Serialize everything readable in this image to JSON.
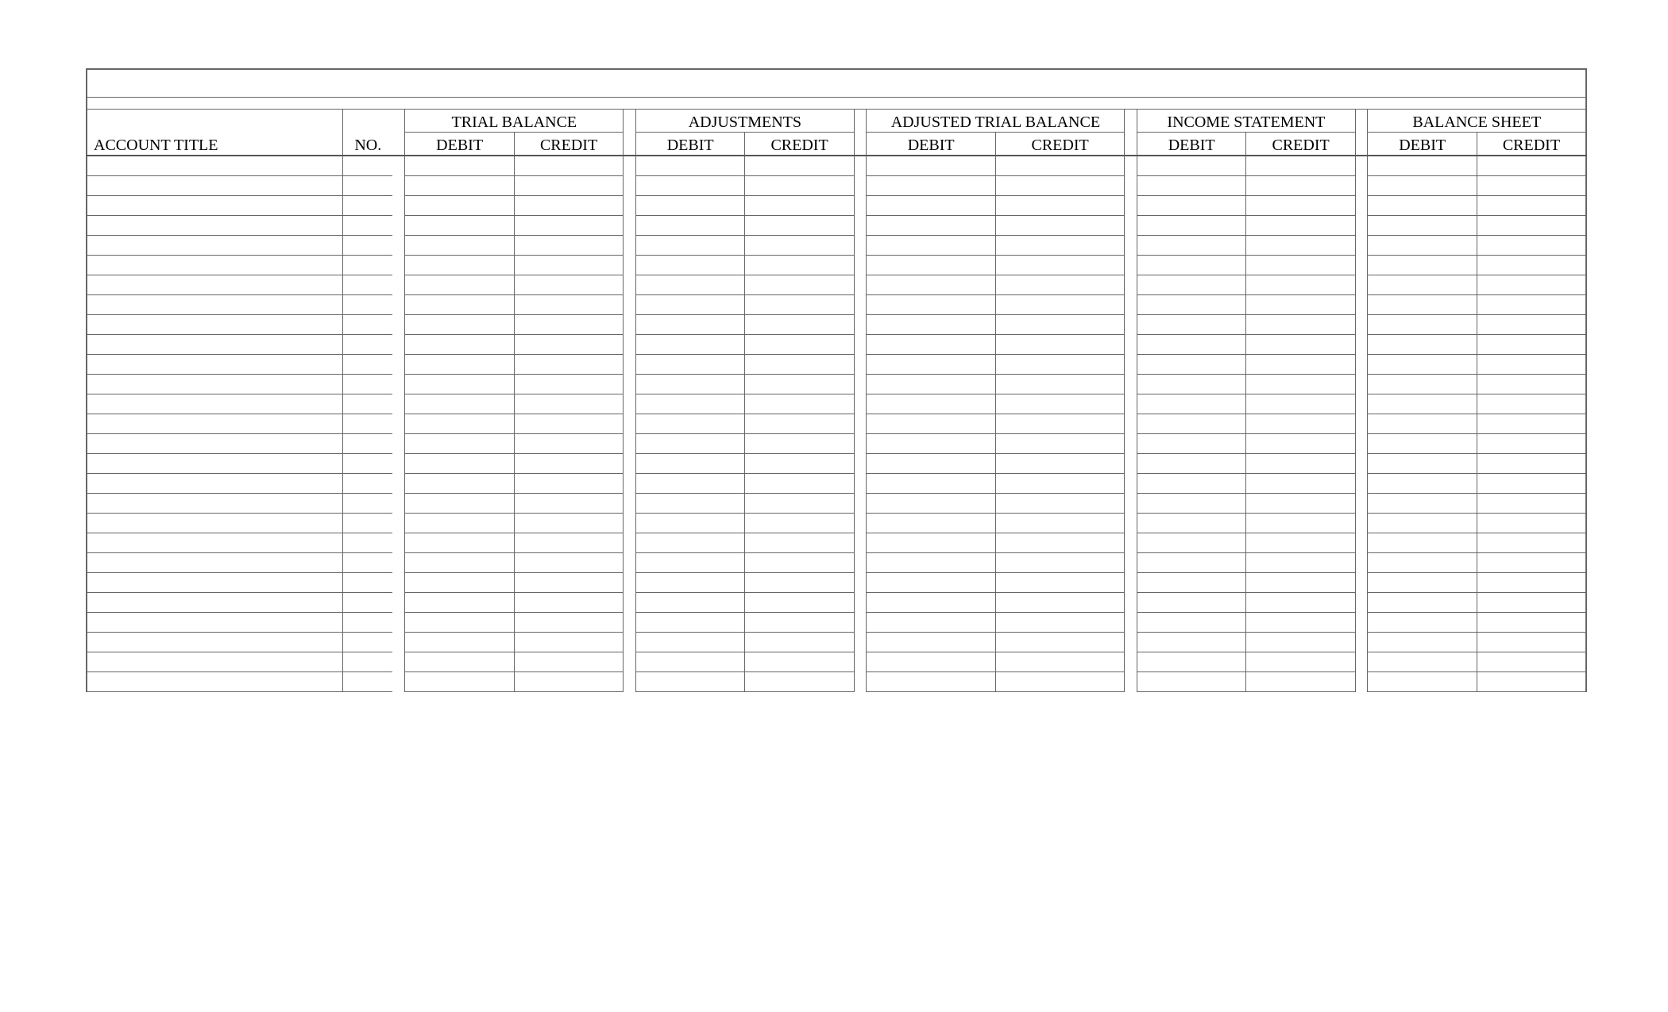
{
  "headers": {
    "account_title": "ACCOUNT TITLE",
    "no": "NO.",
    "debit": "DEBIT",
    "credit": "CREDIT",
    "groups": {
      "trial_balance": "TRIAL BALANCE",
      "adjustments": "ADJUSTMENTS",
      "adjusted_trial_balance": "ADJUSTED TRIAL BALANCE",
      "income_statement": "INCOME STATEMENT",
      "balance_sheet": "BALANCE SHEET"
    }
  },
  "body_row_count": 27
}
